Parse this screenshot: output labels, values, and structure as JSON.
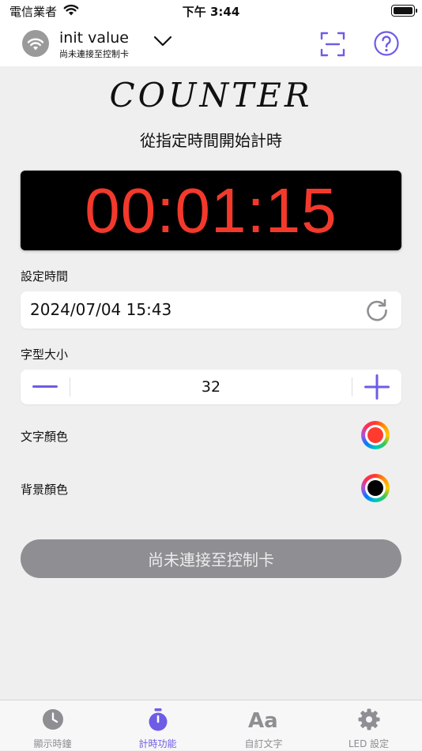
{
  "status_bar": {
    "carrier": "電信業者",
    "time": "下午 3:44"
  },
  "header": {
    "device_name": "init value",
    "device_status": "尚未連接至控制卡",
    "accent_color": "#6d5ce6"
  },
  "main": {
    "logo": "COUNTER",
    "subtitle": "從指定時間開始計時",
    "display_time": "00:01:15",
    "display_text_color": "#f2392c",
    "display_bg_color": "#000000",
    "set_time_label": "設定時間",
    "set_time_value": "2024/07/04 15:43",
    "font_size_label": "字型大小",
    "font_size_value": "32",
    "text_color_label": "文字顏色",
    "text_color_value": "#ff3b30",
    "bg_color_label": "背景顏色",
    "bg_color_value": "#000000",
    "connect_button": "尚未連接至控制卡"
  },
  "tabs": [
    {
      "label": "顯示時鐘",
      "icon": "clock-icon",
      "active": false
    },
    {
      "label": "計時功能",
      "icon": "stopwatch-icon",
      "active": true
    },
    {
      "label": "自訂文字",
      "icon": "text-aa-icon",
      "active": false
    },
    {
      "label": "LED 設定",
      "icon": "gear-icon",
      "active": false
    }
  ]
}
